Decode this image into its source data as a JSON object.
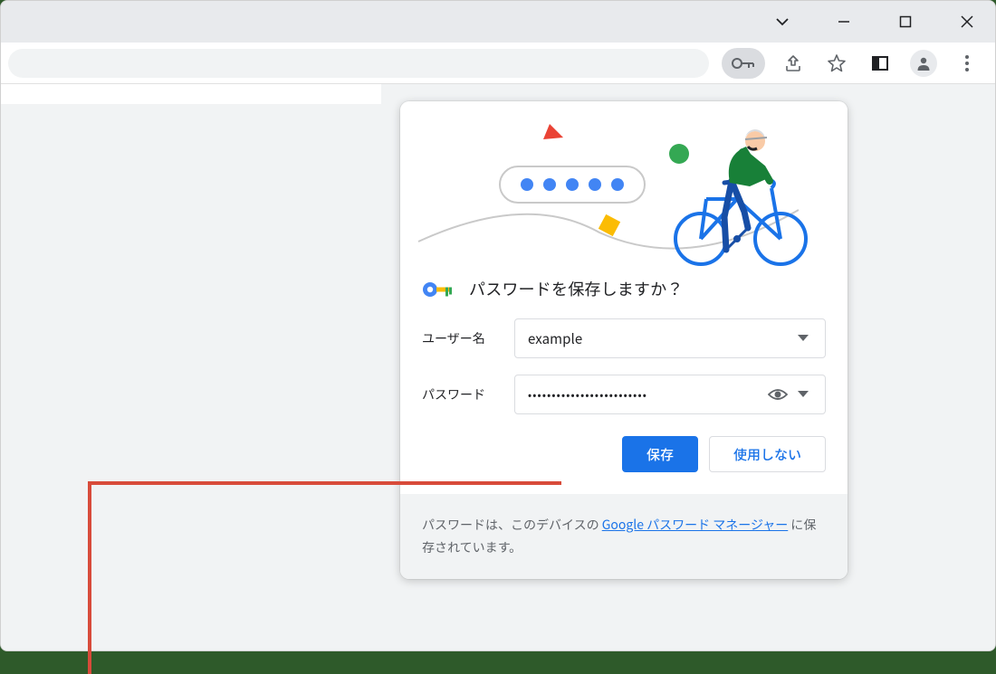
{
  "browser": {
    "toolbar": {
      "icons": {
        "key": "key-icon",
        "share": "share-icon",
        "star": "star-icon",
        "panel": "side-panel-icon",
        "profile": "profile-icon",
        "menu": "menu-icon"
      }
    },
    "window_controls": {
      "dropdown": "dropdown-icon",
      "minimize": "minimize-icon",
      "maximize": "maximize-icon",
      "close": "close-icon"
    }
  },
  "popup": {
    "title": "パスワードを保存しますか？",
    "fields": {
      "username": {
        "label": "ユーザー名",
        "value": "example"
      },
      "password": {
        "label": "パスワード",
        "value": "•••••••••••••••••••••••••"
      }
    },
    "buttons": {
      "save": "保存",
      "never": "使用しない"
    },
    "footer": {
      "prefix": "パスワードは、このデバイスの ",
      "link": "Google パスワード マネージャー",
      "suffix": " に保存されています。"
    }
  },
  "colors": {
    "primary_blue": "#1a73e8",
    "google_blue": "#4285f4",
    "google_red": "#ea4335",
    "google_yellow": "#fbbc04",
    "google_green": "#34a853"
  }
}
